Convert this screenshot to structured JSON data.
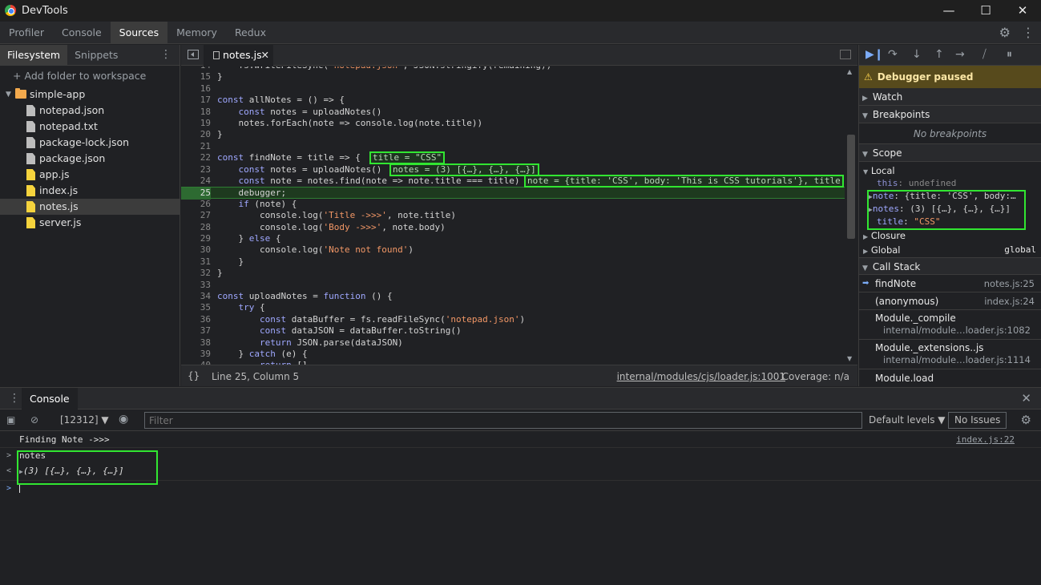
{
  "window": {
    "title": "DevTools",
    "controls": [
      "—",
      "☐",
      "✕"
    ]
  },
  "panel_tabs": [
    "Profiler",
    "Console",
    "Sources",
    "Memory",
    "Redux"
  ],
  "navigator": {
    "tabs": [
      "Filesystem",
      "Snippets"
    ],
    "add_folder": "Add folder to workspace",
    "folder": "simple-app",
    "files": [
      "notepad.json",
      "notepad.txt",
      "package-lock.json",
      "package.json",
      "app.js",
      "index.js",
      "notes.js",
      "server.js"
    ]
  },
  "editor": {
    "tab": "notes.js",
    "lines": [
      {
        "n": "14",
        "html": "    fs.writeFileSync('notepad.json', JSON.stringify(remaining))"
      },
      {
        "n": "15",
        "html": "}"
      },
      {
        "n": "16",
        "html": ""
      },
      {
        "n": "17",
        "html": "const allNotes = () => {"
      },
      {
        "n": "18",
        "html": "    const notes = uploadNotes()"
      },
      {
        "n": "19",
        "html": "    notes.forEach(note => console.log(note.title))"
      },
      {
        "n": "20",
        "html": "}"
      },
      {
        "n": "21",
        "html": ""
      },
      {
        "n": "22",
        "html": "const findNote = title => {"
      },
      {
        "n": "23",
        "html": "    const notes = uploadNotes()"
      },
      {
        "n": "24",
        "html": "    const note = notes.find(note => note.title === title)"
      },
      {
        "n": "25",
        "html": "    debugger;"
      },
      {
        "n": "26",
        "html": "    if (note) {"
      },
      {
        "n": "27",
        "html": "        console.log('Title ->>>', note.title)"
      },
      {
        "n": "28",
        "html": "        console.log('Body ->>>', note.body)"
      },
      {
        "n": "29",
        "html": "    } else {"
      },
      {
        "n": "30",
        "html": "        console.log('Note not found')"
      },
      {
        "n": "31",
        "html": "    }"
      },
      {
        "n": "32",
        "html": "}"
      },
      {
        "n": "33",
        "html": ""
      },
      {
        "n": "34",
        "html": "const uploadNotes = function () {"
      },
      {
        "n": "35",
        "html": "    try {"
      },
      {
        "n": "36",
        "html": "        const dataBuffer = fs.readFileSync('notepad.json')"
      },
      {
        "n": "37",
        "html": "        const dataJSON = dataBuffer.toString()"
      },
      {
        "n": "38",
        "html": "        return JSON.parse(dataJSON)"
      },
      {
        "n": "39",
        "html": "    } catch (e) {"
      },
      {
        "n": "40",
        "html": "        return []"
      }
    ],
    "inline_values": {
      "line22": "title = \"CSS\"",
      "line23": "notes = (3) [{…}, {…}, {…}]",
      "line24": "note = {title: 'CSS', body: 'This is CSS tutorials'}, title"
    },
    "footer": {
      "braces": "{}",
      "position": "Line 25, Column 5",
      "file_link": "internal/modules/cjs/loader.js:1001",
      "coverage": "Coverage: n/a"
    }
  },
  "debugger": {
    "paused": "Debugger paused",
    "watch": "Watch",
    "breakpoints": "Breakpoints",
    "no_breakpoints": "No breakpoints",
    "scope": "Scope",
    "local": "Local",
    "this_row": {
      "key": "this",
      "value": "undefined"
    },
    "note_row": {
      "key": "note",
      "value": "{title: 'CSS', body:…"
    },
    "notes_row": {
      "key": "notes",
      "value": "(3) [{…}, {…}, {…}]"
    },
    "title_row": {
      "key": "title",
      "value": "\"CSS\""
    },
    "closure": "Closure",
    "global": "Global",
    "global_value": "global",
    "call_stack": "Call Stack",
    "frames": [
      {
        "name": "findNote",
        "loc": "notes.js:25"
      },
      {
        "name": "(anonymous)",
        "loc": "index.js:24"
      },
      {
        "name": "Module._compile",
        "loc": "internal/module…loader.js:1082"
      },
      {
        "name": "Module._extensions..js",
        "loc": "internal/module…loader.js:1114"
      },
      {
        "name": "Module.load",
        "loc": ""
      }
    ]
  },
  "drawer": {
    "tab": "Console",
    "context": "[12312] ▼",
    "filter_placeholder": "Filter",
    "levels": "Default levels ▼",
    "issues": "No Issues",
    "logs": [
      {
        "text": "Finding Note ->>>",
        "link": "index.js:22"
      },
      {
        "text": "notes"
      },
      {
        "text": "(3) [{…}, {…}, {…}]"
      }
    ]
  }
}
